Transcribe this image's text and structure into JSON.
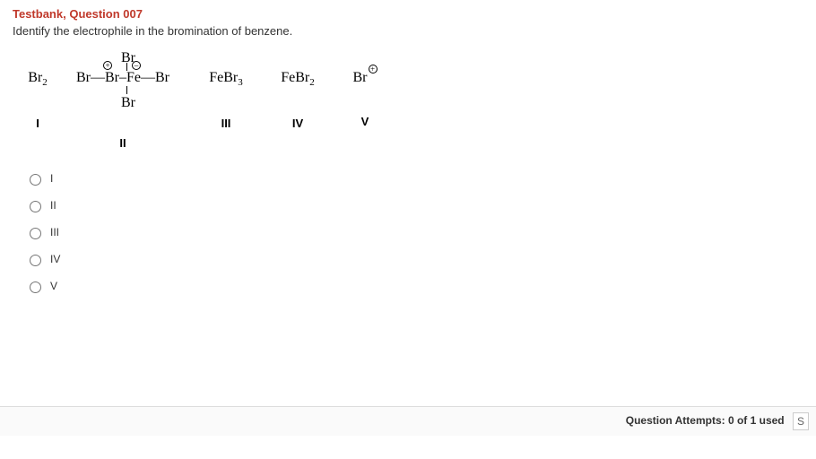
{
  "title": "Testbank, Question 007",
  "prompt": "Identify the electrophile in the bromination of benzene.",
  "options_display": {
    "I": {
      "formula_html": "Br<span class='sub'>2</span>",
      "label": "I"
    },
    "II": {
      "top": "Br",
      "bottom": "Br",
      "main_html": "Br—Br–Fe—Br",
      "plus": "+",
      "minus": "–",
      "label": "II"
    },
    "III": {
      "formula_html": "FeBr<span class='sub'>3</span>",
      "label": "III"
    },
    "IV": {
      "formula_html": "FeBr<span class='sub'>2</span>",
      "label": "IV"
    },
    "V": {
      "formula_html": "Br",
      "charge": "+",
      "label": "V"
    }
  },
  "choices": [
    "I",
    "II",
    "III",
    "IV",
    "V"
  ],
  "footer": {
    "attempts_text": "Question Attempts: 0 of 1 used",
    "button_fragment": "S"
  }
}
